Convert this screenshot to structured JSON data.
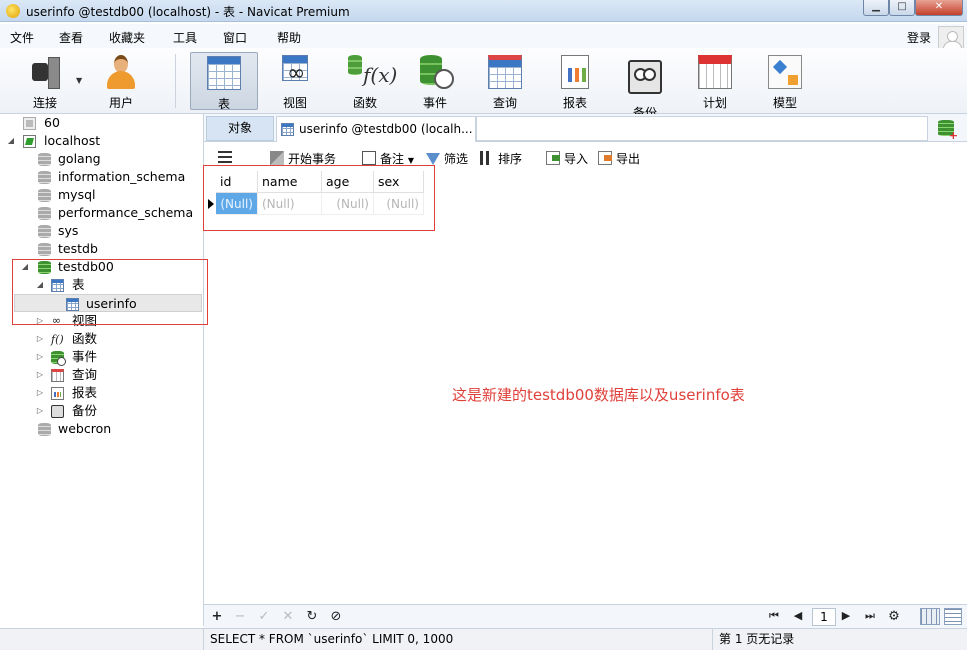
{
  "window": {
    "title": "userinfo @testdb00 (localhost) - 表 - Navicat Premium",
    "minimize": "▁",
    "maximize": "□",
    "close": "✕"
  },
  "menubar": {
    "items": [
      "文件",
      "查看",
      "收藏夹",
      "工具",
      "窗口",
      "帮助"
    ],
    "login": "登录"
  },
  "toolbar": {
    "buttons": [
      {
        "label": "连接",
        "icon": "plug-icon"
      },
      {
        "label": "用户",
        "icon": "user-icon"
      },
      {
        "label": "表",
        "icon": "table-icon",
        "active": true
      },
      {
        "label": "视图",
        "icon": "view-icon"
      },
      {
        "label": "函数",
        "icon": "function-icon"
      },
      {
        "label": "事件",
        "icon": "event-icon"
      },
      {
        "label": "查询",
        "icon": "query-icon"
      },
      {
        "label": "报表",
        "icon": "report-icon"
      },
      {
        "label": "备份",
        "icon": "backup-icon"
      },
      {
        "label": "计划",
        "icon": "schedule-icon"
      },
      {
        "label": "模型",
        "icon": "model-icon"
      }
    ]
  },
  "sidebar": {
    "tree": [
      {
        "label": "60",
        "icon": "connection-gray-icon"
      },
      {
        "label": "localhost",
        "icon": "connection-icon",
        "expanded": true
      },
      {
        "label": "golang",
        "icon": "database-gray-icon"
      },
      {
        "label": "information_schema",
        "icon": "database-gray-icon"
      },
      {
        "label": "mysql",
        "icon": "database-gray-icon"
      },
      {
        "label": "performance_schema",
        "icon": "database-gray-icon"
      },
      {
        "label": "sys",
        "icon": "database-gray-icon"
      },
      {
        "label": "testdb",
        "icon": "database-gray-icon"
      },
      {
        "label": "testdb00",
        "icon": "database-green-icon",
        "expanded": true
      },
      {
        "label": "表",
        "icon": "table-icon",
        "expanded": true
      },
      {
        "label": "userinfo",
        "icon": "table-icon",
        "selected": true
      },
      {
        "label": "视图",
        "icon": "view-icon"
      },
      {
        "label": "函数",
        "icon": "function-icon"
      },
      {
        "label": "事件",
        "icon": "event-icon"
      },
      {
        "label": "查询",
        "icon": "query-icon"
      },
      {
        "label": "报表",
        "icon": "report-icon"
      },
      {
        "label": "备份",
        "icon": "backup-icon"
      },
      {
        "label": "webcron",
        "icon": "database-gray-icon"
      }
    ]
  },
  "tabs": {
    "objects": "对象",
    "active": "userinfo @testdb00 (localh..."
  },
  "objtoolbar": {
    "begin_tx": "开始事务",
    "note": "备注",
    "filter": "筛选",
    "sort": "排序",
    "import": "导入",
    "export": "导出"
  },
  "grid": {
    "columns": [
      "id",
      "name",
      "age",
      "sex"
    ],
    "rows": [
      [
        "(Null)",
        "(Null)",
        "(Null)",
        "(Null)"
      ]
    ]
  },
  "annotation": "这是新建的testdb00数据库以及userinfo表",
  "bottombar": {
    "add": "+",
    "remove": "−",
    "apply": "✓",
    "discard": "✕",
    "refresh": "↻",
    "stop": "⊘",
    "first": "⏮",
    "prev": "◀",
    "page": "1",
    "next": "▶",
    "last": "⏭",
    "settings": "⚙"
  },
  "status": {
    "sql": "SELECT * FROM `userinfo` LIMIT 0, 1000",
    "page_info": "第 1 页无记录"
  },
  "colors": {
    "annotation": "#e0403a",
    "selected_cell": "#5fa8e8"
  }
}
